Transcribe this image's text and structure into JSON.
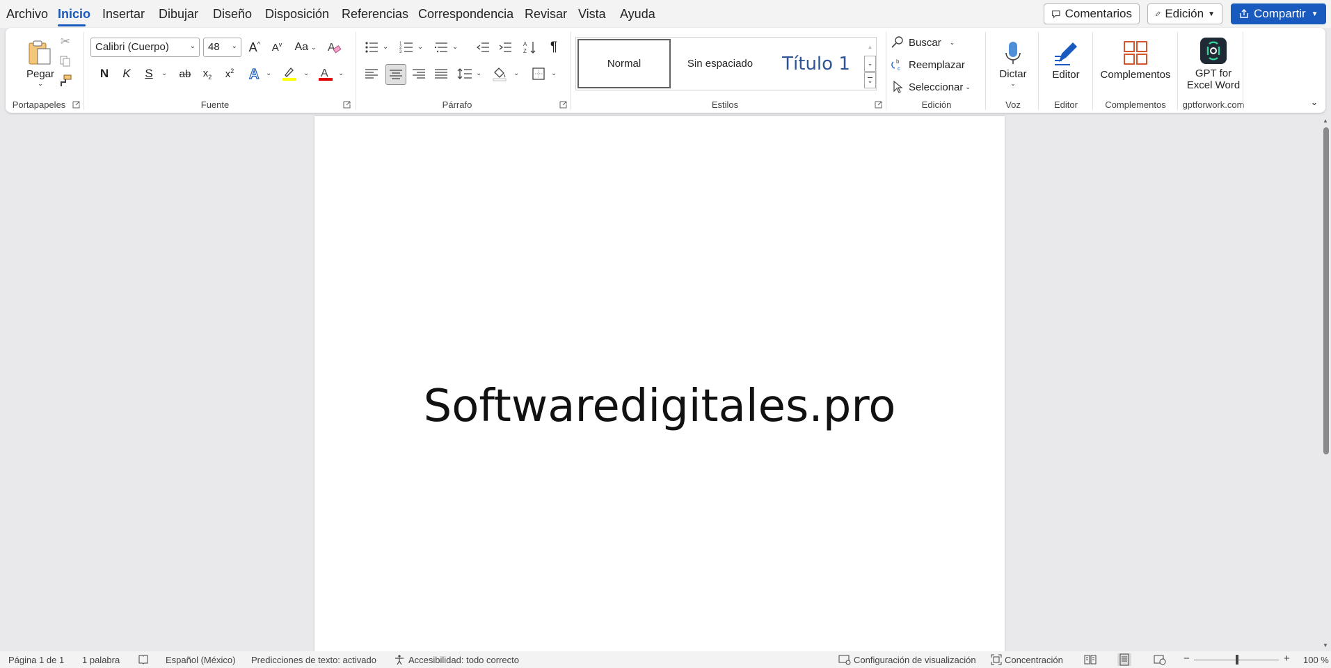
{
  "menu": {
    "tabs": [
      "Archivo",
      "Inicio",
      "Insertar",
      "Dibujar",
      "Diseño",
      "Disposición",
      "Referencias",
      "Correspondencia",
      "Revisar",
      "Vista",
      "Ayuda"
    ],
    "active_tab": "Inicio",
    "comments_label": "Comentarios",
    "editing_label": "Edición",
    "share_label": "Compartir"
  },
  "ribbon": {
    "clipboard": {
      "paste_label": "Pegar",
      "group_label": "Portapapeles"
    },
    "font": {
      "font_name": "Calibri (Cuerpo)",
      "font_size": "48",
      "change_case_label": "Aa",
      "bold_label": "N",
      "italic_label": "K",
      "underline_label": "S",
      "strike_label": "ab",
      "group_label": "Fuente"
    },
    "paragraph": {
      "group_label": "Párrafo"
    },
    "styles": {
      "items": [
        "Normal",
        "Sin espaciado",
        "Título 1"
      ],
      "group_label": "Estilos"
    },
    "editing": {
      "find_label": "Buscar",
      "replace_label": "Reemplazar",
      "select_label": "Seleccionar",
      "group_label": "Edición"
    },
    "voice": {
      "dictate_label": "Dictar",
      "group_label": "Voz"
    },
    "editor": {
      "editor_label": "Editor",
      "group_label": "Editor"
    },
    "addins": {
      "addins_label": "Complementos",
      "group_label": "Complementos"
    },
    "gptforwork": {
      "button_label_line1": "GPT for",
      "button_label_line2": "Excel Word",
      "group_label": "gptforwork.com"
    }
  },
  "document": {
    "text": "Softwaredigitales.pro"
  },
  "status": {
    "page": "Página 1 de 1",
    "words": "1 palabra",
    "language": "Español (México)",
    "predictions": "Predicciones de texto: activado",
    "accessibility": "Accesibilidad: todo correcto",
    "display_settings": "Configuración de visualización",
    "focus": "Concentración",
    "zoom_minus": "−",
    "zoom_plus": "+",
    "zoom": "100 %"
  },
  "colors": {
    "accent": "#185abd",
    "highlight": "#ffff00",
    "font_color": "#e00000"
  }
}
